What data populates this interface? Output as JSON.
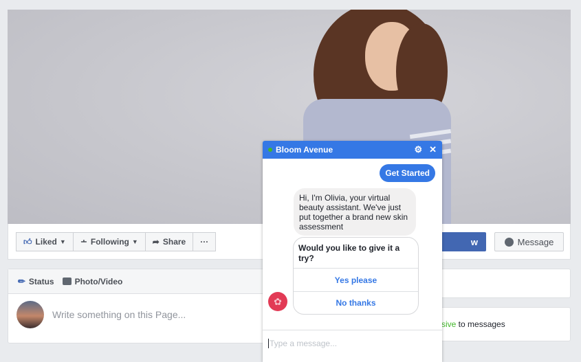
{
  "actions": {
    "liked": "Liked",
    "following": "Following",
    "share": "Share",
    "more": "···",
    "blue_button_tail": "w",
    "message": "Message"
  },
  "composer": {
    "status": "Status",
    "photo_video": "Photo/Video",
    "placeholder": "Write something on this Page..."
  },
  "sidebar": {
    "responsive_fragment": "sive",
    "responsive_rest": " to messages"
  },
  "chat": {
    "page_name": "Bloom Avenue",
    "get_started": "Get Started",
    "bot_message": "Hi, I'm Olivia, your virtual beauty assistant.  We've just put together a brand new skin assessment",
    "question": "Would you like to give it a try?",
    "options": [
      "Yes please",
      "No thanks"
    ],
    "input_placeholder": "Type a message..."
  },
  "colors": {
    "facebook_blue": "#4267b2",
    "messenger_blue": "#3578e5",
    "online_green": "#42b72a",
    "bot_avatar": "#e23a55"
  }
}
